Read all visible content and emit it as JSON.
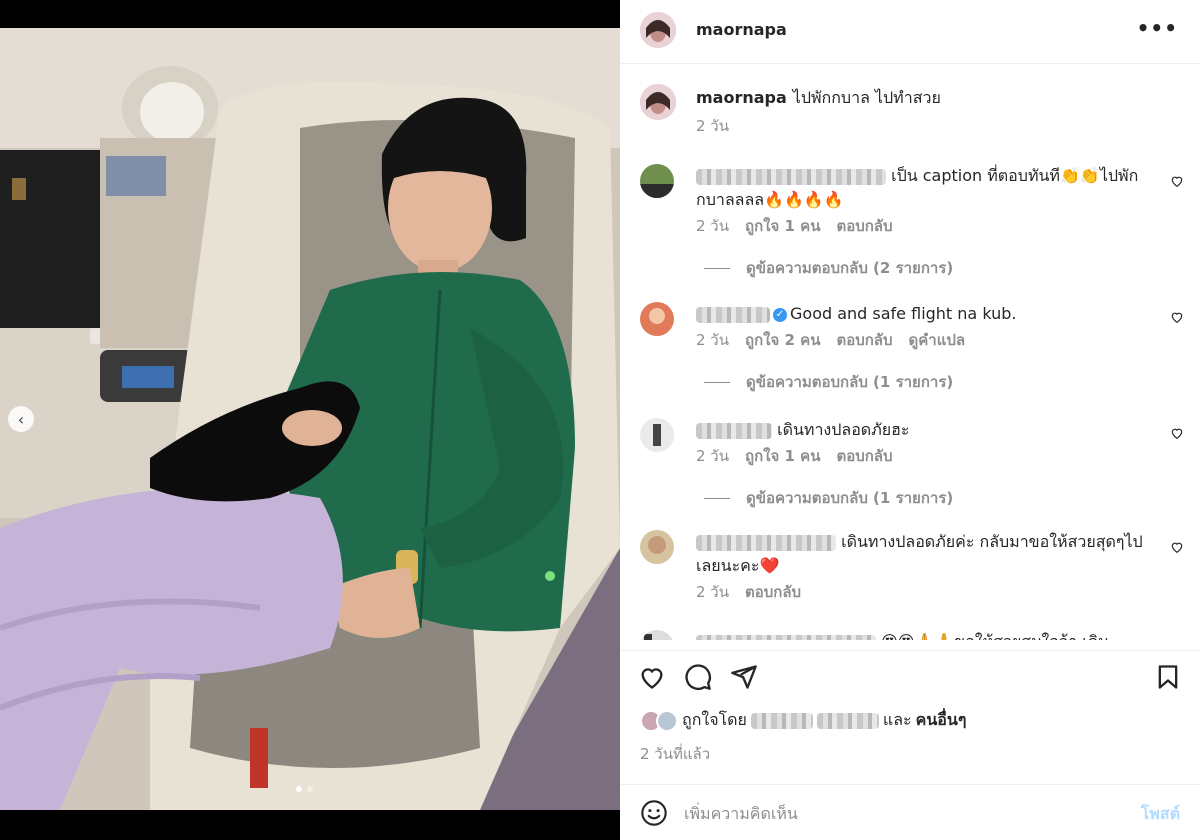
{
  "post": {
    "username": "maornapa",
    "more_label": "•••",
    "caption": {
      "username": "maornapa",
      "text": "ไปพักกบาล ไปทำสวย",
      "time": "2 วัน"
    },
    "comments": [
      {
        "text": "เป็น caption ที่ตอบทันที👏👏ไปพักกบาลลลล🔥🔥🔥🔥",
        "time": "2 วัน",
        "likes": "ถูกใจ 1 คน",
        "reply": "ตอบกลับ",
        "replies_label": "ดูข้อความตอบกลับ (2 รายการ)"
      },
      {
        "text": "Good and safe flight na kub.",
        "time": "2 วัน",
        "likes": "ถูกใจ 2 คน",
        "reply": "ตอบกลับ",
        "translate": "ดูคำแปล",
        "replies_label": "ดูข้อความตอบกลับ (1 รายการ)"
      },
      {
        "text": "เดินทางปลอดภัยฮะ",
        "time": "2 วัน",
        "likes": "ถูกใจ 1 คน",
        "reply": "ตอบกลับ",
        "replies_label": "ดูข้อความตอบกลับ (1 รายการ)"
      },
      {
        "text": "เดินทางปลอดภัยค่ะ กลับมาขอให้สวยสุดๆไปเลยนะคะ❤️",
        "time": "2 วัน",
        "reply": "ตอบกลับ"
      },
      {
        "text": "😍😍🙏🙏ขอให้สวยสมใจจ้า เดิน"
      }
    ],
    "likes_prefix": "ถูกใจโดย",
    "likes_suffix": "และ",
    "likes_others": "คนอื่นๆ",
    "post_time": "2 วันที่แล้ว",
    "add_comment_placeholder": "เพิ่มความคิดเห็น",
    "post_button": "โพสต์",
    "nav_prev": "‹"
  },
  "colors": {
    "accent_blue": "#3897f0",
    "post_button_disabled": "#b3dbff",
    "secondary_text": "#8e8e8e"
  }
}
